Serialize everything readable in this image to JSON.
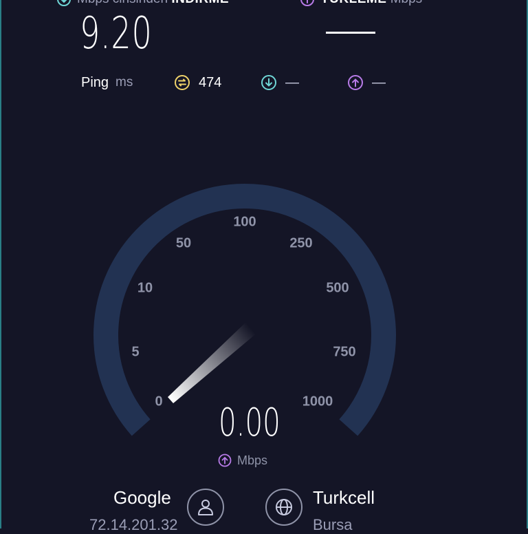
{
  "results": {
    "download": {
      "label_prefix": "Mbps cinsinden",
      "label_strong": "İNDİRME",
      "value": "9.20",
      "icon": "download-arrow-icon",
      "color": "#6fd6d6"
    },
    "upload": {
      "label_strong": "YÜKLEME",
      "label_suffix": "Mbps",
      "value": "",
      "icon": "upload-arrow-icon",
      "color": "#b87be8"
    }
  },
  "ping": {
    "label": "Ping",
    "unit": "ms",
    "idle_value": "474",
    "download_value": "—",
    "upload_value": "—",
    "idle_color": "#f0d36a"
  },
  "gauge": {
    "ticks": [
      "0",
      "5",
      "10",
      "50",
      "100",
      "250",
      "500",
      "750",
      "1000"
    ],
    "value": "0.00",
    "unit": "Mbps",
    "needle_level": 0,
    "track_color": "#223252"
  },
  "server": {
    "host": "Google",
    "ip": "72.14.201.32",
    "isp": "Turkcell",
    "city": "Bursa"
  }
}
